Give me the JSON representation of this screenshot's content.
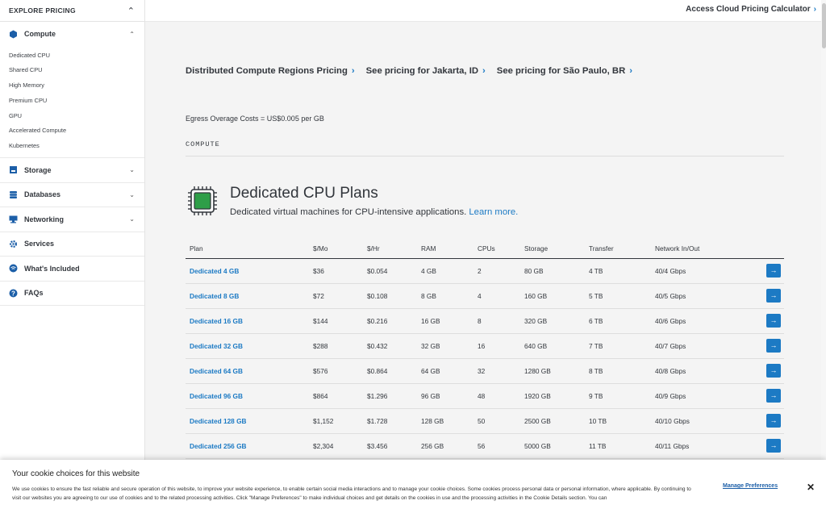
{
  "sidebar": {
    "header": "EXPLORE PRICING",
    "compute_label": "Compute",
    "sub_items": [
      "Dedicated CPU",
      "Shared CPU",
      "High Memory",
      "Premium CPU",
      "GPU",
      "Accelerated Compute",
      "Kubernetes"
    ],
    "items": [
      {
        "label": "Storage"
      },
      {
        "label": "Databases"
      },
      {
        "label": "Networking"
      },
      {
        "label": "Services"
      },
      {
        "label": "What's Included"
      },
      {
        "label": "FAQs"
      }
    ]
  },
  "topbar": {
    "calculator_link": "Access Cloud Pricing Calculator"
  },
  "links": [
    "Distributed Compute Regions Pricing",
    "See pricing for Jakarta, ID",
    "See pricing for São Paulo, BR"
  ],
  "egress": "Egress Overage Costs = US$0.005 per GB",
  "section": "COMPUTE",
  "plans": {
    "title": "Dedicated CPU Plans",
    "subtitle": "Dedicated virtual machines for CPU-intensive applications.",
    "learn_more": "Learn more.",
    "columns": [
      "Plan",
      "$/Mo",
      "$/Hr",
      "RAM",
      "CPUs",
      "Storage",
      "Transfer",
      "Network In/Out"
    ],
    "rows": [
      [
        "Dedicated 4 GB",
        "$36",
        "$0.054",
        "4 GB",
        "2",
        "80 GB",
        "4 TB",
        "40/4 Gbps"
      ],
      [
        "Dedicated 8 GB",
        "$72",
        "$0.108",
        "8 GB",
        "4",
        "160 GB",
        "5 TB",
        "40/5 Gbps"
      ],
      [
        "Dedicated 16 GB",
        "$144",
        "$0.216",
        "16 GB",
        "8",
        "320 GB",
        "6 TB",
        "40/6 Gbps"
      ],
      [
        "Dedicated 32 GB",
        "$288",
        "$0.432",
        "32 GB",
        "16",
        "640 GB",
        "7 TB",
        "40/7 Gbps"
      ],
      [
        "Dedicated 64 GB",
        "$576",
        "$0.864",
        "64 GB",
        "32",
        "1280 GB",
        "8 TB",
        "40/8 Gbps"
      ],
      [
        "Dedicated 96 GB",
        "$864",
        "$1.296",
        "96 GB",
        "48",
        "1920 GB",
        "9 TB",
        "40/9 Gbps"
      ],
      [
        "Dedicated 128 GB",
        "$1,152",
        "$1.728",
        "128 GB",
        "50",
        "2500 GB",
        "10 TB",
        "40/10 Gbps"
      ],
      [
        "Dedicated 256 GB",
        "$2,304",
        "$3.456",
        "256 GB",
        "56",
        "5000 GB",
        "11 TB",
        "40/11 Gbps"
      ]
    ]
  },
  "cookie": {
    "title": "Your cookie choices for this website",
    "text": "We use cookies to ensure the fast reliable and secure operation of this website, to improve your website experience, to enable certain social media interactions and to manage your cookie choices. Some cookies process personal data or personal information, where applicable. By continuing to visit our websites you are agreeing to our use of cookies and to the related processing activities. Click \"Manage Preferences\" to make individual choices and get details on the cookies in use and the processing activities in the Cookie Details section. You can",
    "manage": "Manage Preferences",
    "close": "✕"
  },
  "colors": {
    "accent": "#1c7ac4",
    "chip_green": "#2e9e48",
    "text": "#32363c"
  }
}
